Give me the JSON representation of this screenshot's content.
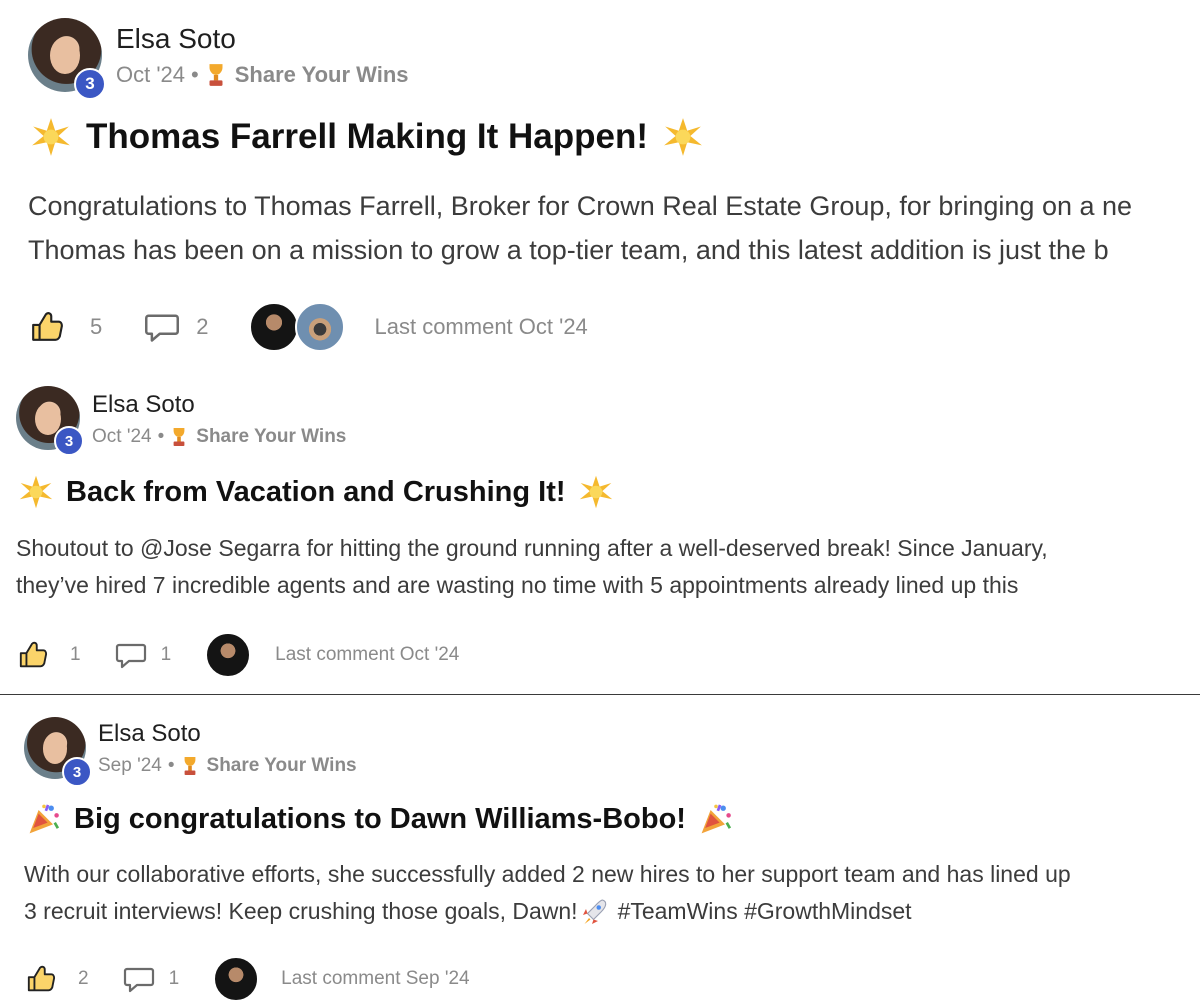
{
  "posts": [
    {
      "author": "Elsa Soto",
      "level": "3",
      "date": "Oct '24",
      "separator": "•",
      "category": "Share Your Wins",
      "title": "Thomas Farrell Making It Happen!",
      "title_emoji": "sparkle",
      "body_lines": [
        "Congratulations to Thomas Farrell, Broker for Crown Real Estate Group, for bringing on a ne",
        "Thomas has been on a mission to grow a top-tier team, and this latest addition is just the b"
      ],
      "likes": "5",
      "comments": "2",
      "last_comment": "Last comment Oct '24"
    },
    {
      "author": "Elsa Soto",
      "level": "3",
      "date": "Oct '24",
      "separator": "•",
      "category": "Share Your Wins",
      "title": "Back from Vacation and Crushing It!",
      "title_emoji": "sparkle",
      "body_lines": [
        "Shoutout to @Jose Segarra for hitting the ground running after a well-deserved break! Since January,",
        "they’ve hired 7 incredible agents and are wasting no time with 5 appointments already lined up this"
      ],
      "likes": "1",
      "comments": "1",
      "last_comment": "Last comment Oct '24"
    },
    {
      "author": "Elsa Soto",
      "level": "3",
      "date": "Sep '24",
      "separator": "•",
      "category": "Share Your Wins",
      "title": "Big congratulations to Dawn Williams-Bobo!",
      "title_emoji": "party-popper",
      "body_lines": [
        "With our collaborative efforts, she successfully added 2 new hires to her support team and has lined up",
        "3 recruit interviews! Keep crushing those goals, Dawn! ",
        "#TeamWins #GrowthMindset"
      ],
      "likes": "2",
      "comments": "1",
      "last_comment": "Last comment Sep '24"
    }
  ],
  "colors": {
    "level_badge": "#3b57c4",
    "text_primary": "#1f1f1f",
    "text_muted": "#8a8a8a",
    "sparkle": "#f5b92e",
    "divider": "#3a3a3a"
  },
  "icons": [
    "like-icon",
    "comment-icon",
    "trophy-icon",
    "sparkle-icon",
    "party-popper-icon",
    "rocket-icon"
  ]
}
